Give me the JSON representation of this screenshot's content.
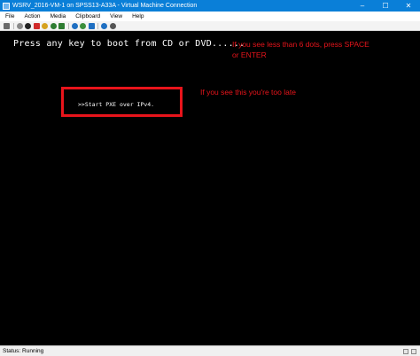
{
  "window": {
    "title": "WSRV_2016-VM-1 on SPSS13-A33A - Virtual Machine Connection",
    "controls": [
      "–",
      "☐",
      "✕"
    ]
  },
  "menu": [
    "File",
    "Action",
    "Media",
    "Clipboard",
    "View",
    "Help"
  ],
  "toolbar": {
    "buttons": [
      {
        "name": "ctrl-alt-del-icon",
        "color": "#6a6a6a"
      },
      {
        "name": "start-icon",
        "color": "#8a8a8a"
      },
      {
        "name": "turn-off-icon",
        "color": "#222222"
      },
      {
        "name": "shutdown-icon",
        "color": "#d12b2b"
      },
      {
        "name": "power-icon",
        "color": "#d6a21e"
      },
      {
        "name": "pause-icon",
        "color": "#2e7d32"
      },
      {
        "name": "resume-icon",
        "color": "#2e7d32"
      },
      {
        "name": "reset-icon",
        "color": "#1f6fc2"
      },
      {
        "name": "checkpoint-icon",
        "color": "#3c8f3c"
      },
      {
        "name": "revert-icon",
        "color": "#1f6fc2"
      },
      {
        "name": "enhanced-session-icon",
        "color": "#1f6fc2"
      },
      {
        "name": "share-icon",
        "color": "#555555"
      }
    ]
  },
  "screen": {
    "boot_message": "Press any key to boot from CD or DVD......",
    "pxe_message": ">>Start PXE over IPv4.",
    "annotations": {
      "dots_note": "If you see less than 6 dots, press SPACE or ENTER",
      "late_note": "If you see this you're too late"
    },
    "annotation_color": "#e8141b"
  },
  "status": {
    "text": "Status: Running"
  }
}
